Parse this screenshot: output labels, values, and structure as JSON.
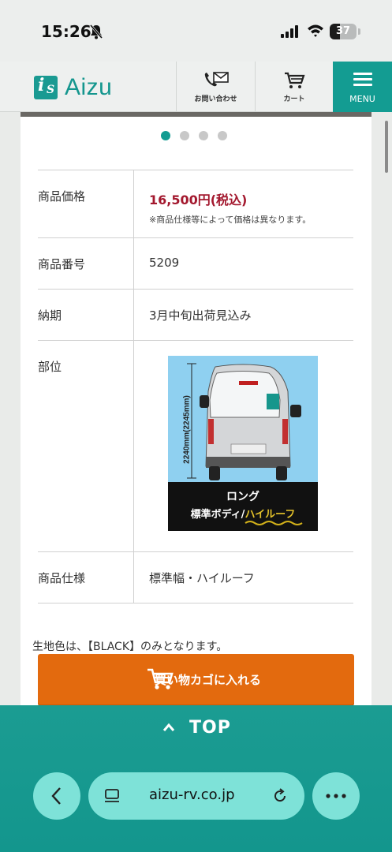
{
  "status_bar": {
    "time": "15:26",
    "battery": "37",
    "battery_level_percent": 37
  },
  "header": {
    "logo_text": "Aizu",
    "contact_label": "お問い合わせ",
    "cart_label": "カート",
    "menu_label": "MENU"
  },
  "carousel": {
    "slide_count": 4,
    "active_index": 0
  },
  "spec": {
    "price_label": "商品価格",
    "price_value": "16,500円(税込)",
    "price_note": "※商品仕様等によって価格は異なります。",
    "number_label": "商品番号",
    "number_value": "5209",
    "delivery_label": "納期",
    "delivery_value": "3月中旬出荷見込み",
    "part_label": "部位",
    "part_image": {
      "height_text": "2240mm(2245mm)",
      "line1": "ロング",
      "line2a": "標準ボディ/",
      "line2b": "ハイルーフ"
    },
    "spec_label": "商品仕様",
    "spec_value": "標準幅・ハイルーフ"
  },
  "fabric_note": "生地色は、【BLACK】のみとなります。",
  "cart_button_label": "買い物カゴに入れる",
  "top_link": "TOP",
  "browser": {
    "url": "aizu-rv.co.jp"
  },
  "colors": {
    "brand": "#139c92",
    "price": "#a3182e",
    "cart_button": "#e36a0e"
  }
}
